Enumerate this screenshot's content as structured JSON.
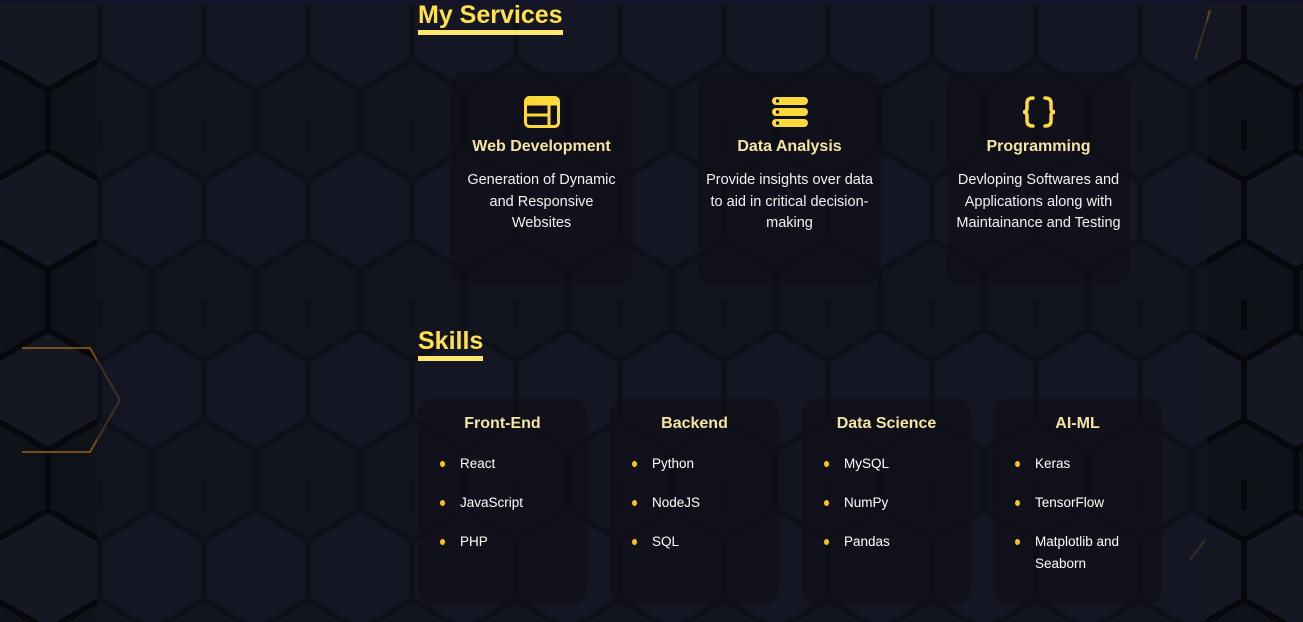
{
  "colors": {
    "accent": "#ffe14d",
    "card_title": "#f4e6a2",
    "bullet": "#f9c80e",
    "background": "#0d0f16"
  },
  "services": {
    "heading": "My Services",
    "items": [
      {
        "icon": "browser-window-icon",
        "title": "Web Development",
        "description": "Generation of Dynamic and Responsive Websites"
      },
      {
        "icon": "server-stack-icon",
        "title": "Data Analysis",
        "description": "Provide insights over data to aid in critical decision-making"
      },
      {
        "icon": "curly-braces-icon",
        "title": "Programming",
        "description": "Devloping Softwares and Applications along with Maintainance and Testing"
      }
    ]
  },
  "skills": {
    "heading": "Skills",
    "groups": [
      {
        "title": "Front-End",
        "items": [
          "React",
          "JavaScript",
          "PHP"
        ]
      },
      {
        "title": "Backend",
        "items": [
          "Python",
          "NodeJS",
          "SQL"
        ]
      },
      {
        "title": "Data Science",
        "items": [
          "MySQL",
          "NumPy",
          "Pandas"
        ]
      },
      {
        "title": "AI-ML",
        "items": [
          "Keras",
          "TensorFlow",
          "Matplotlib and Seaborn"
        ]
      }
    ]
  }
}
